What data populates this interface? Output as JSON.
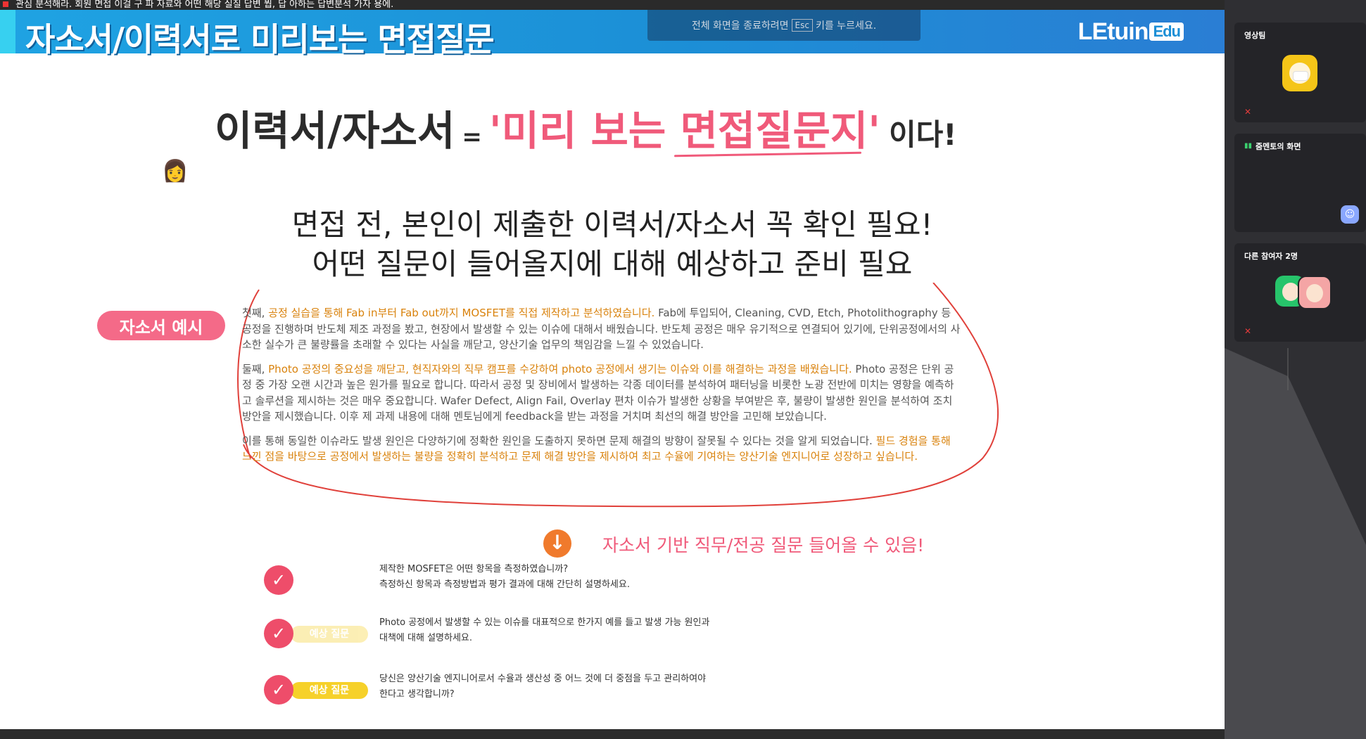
{
  "ticker": {
    "text": "관심 분석해라. 회원 면접 이걸 구 파 자료와 어떤 해당 실질 답변 뭡, 답 아하는 답변분석 가자 용에."
  },
  "banner": {
    "title": "자소서/이력서로 미리보는 면접질문",
    "logo": "LEtuin",
    "logo_suffix": "Edu"
  },
  "esc_hint": {
    "before": "전체 화면을 종료하려면",
    "key": "Esc",
    "after": "키를 누르세요."
  },
  "headline": {
    "left": "이력서/자소서",
    "eq": "=",
    "quote": "'미리 보는 면접질문지'",
    "tail": "이다!"
  },
  "subtitle": {
    "line1": "면접 전, 본인이 제출한 이력서/자소서 꼭 확인 필요!",
    "line2": "어떤 질문이 들어올지에 대해 예상하고 준비 필요"
  },
  "essay": {
    "tag": "자소서 예시",
    "p1": {
      "prefix": "첫째, ",
      "highlight": "공정 실습을 통해 Fab in부터 Fab out까지 MOSFET를 직접 제작하고 분석하였습니다.",
      "rest": " Fab에 투입되어, Cleaning, CVD, Etch, Photolithography 등 공정을 진행하며 반도체 제조 과정을 봤고, 현장에서 발생할 수 있는 이슈에 대해서 배웠습니다. 반도체 공정은 매우 유기적으로 연결되어 있기에, 단위공정에서의 사소한 실수가 큰 불량률을 초래할 수 있다는 사실을 깨닫고, 양산기술 업무의 책임감을 느낄 수 있었습니다."
    },
    "p2": {
      "prefix": "둘째, ",
      "highlight": "Photo 공정의 중요성을 깨닫고, 현직자와의 직무 캠프를 수강하여 photo 공정에서 생기는 이슈와 이를 해결하는 과정을 배웠습니다.",
      "rest": " Photo 공정은 단위 공정 중 가장 오랜 시간과 높은 원가를 필요로 합니다. 따라서 공정 및 장비에서 발생하는 각종 데이터를 분석하여 패터닝을 비롯한 노광 전반에 미치는 영향을 예측하고 솔루션을 제시하는 것은 매우 중요합니다. Wafer Defect, Align Fail, Overlay 편차 이슈가 발생한 상황을 부여받은 후, 불량이 발생한 원인을 분석하여 조치 방안을 제시했습니다. 이후 제 과제 내용에 대해 멘토님에게 feedback을 받는 과정을 거치며 최선의 해결 방안을 고민해 보았습니다."
    },
    "p3": {
      "prefix": "이를 통해 동일한 이슈라도 발생 원인은 다양하기에 정확한 원인을 도출하지 못하면 문제 해결의 방향이 잘못될 수 있다는 것을 알게 되었습니다. ",
      "highlight": "필드 경험을 통해 느낀 점을 바탕으로 공정에서 발생하는 불량을 정확히 분석하고 문제 해결 방안을 제시하여 최고 수율에 기여하는 양산기술 엔지니어로 성장하고 싶습니다.",
      "rest": ""
    }
  },
  "arrow_note": "자소서 기반 직무/전공 질문 들어올 수 있음!",
  "questions": [
    {
      "badge": "",
      "line1": "제작한 MOSFET은 어떤 항목을 측정하였습니까?",
      "line2": "측정하신 항목과 측정방법과 평가 결과에 대해 간단히 설명하세요."
    },
    {
      "badge": "예상 질문",
      "line1": "Photo 공정에서 발생할 수 있는 이슈를 대표적으로 한가지 예를 들고 발생 가능 원인과",
      "line2": "대책에 대해 설명하세요."
    },
    {
      "badge": "예상 질문",
      "line1": "당신은 양산기술 엔지니어로서 수율과 생산성 중 어느 것에 더 중점을 두고 관리하여야",
      "line2": "한다고 생각합니까?"
    }
  ],
  "sidebar": {
    "tiles": [
      {
        "name": "영상팀",
        "mic_muted": true
      },
      {
        "name": "줌멘토의 화면",
        "mic_muted": false
      },
      {
        "name": "다른 참여자 2명",
        "mic_muted": true
      }
    ]
  },
  "colors": {
    "banner": "#1c8fd6",
    "accent_pink": "#f05a7a",
    "highlight_orange": "#d9820c",
    "check_red": "#ee4d6a",
    "badge_yellow": "#f6d12a"
  }
}
